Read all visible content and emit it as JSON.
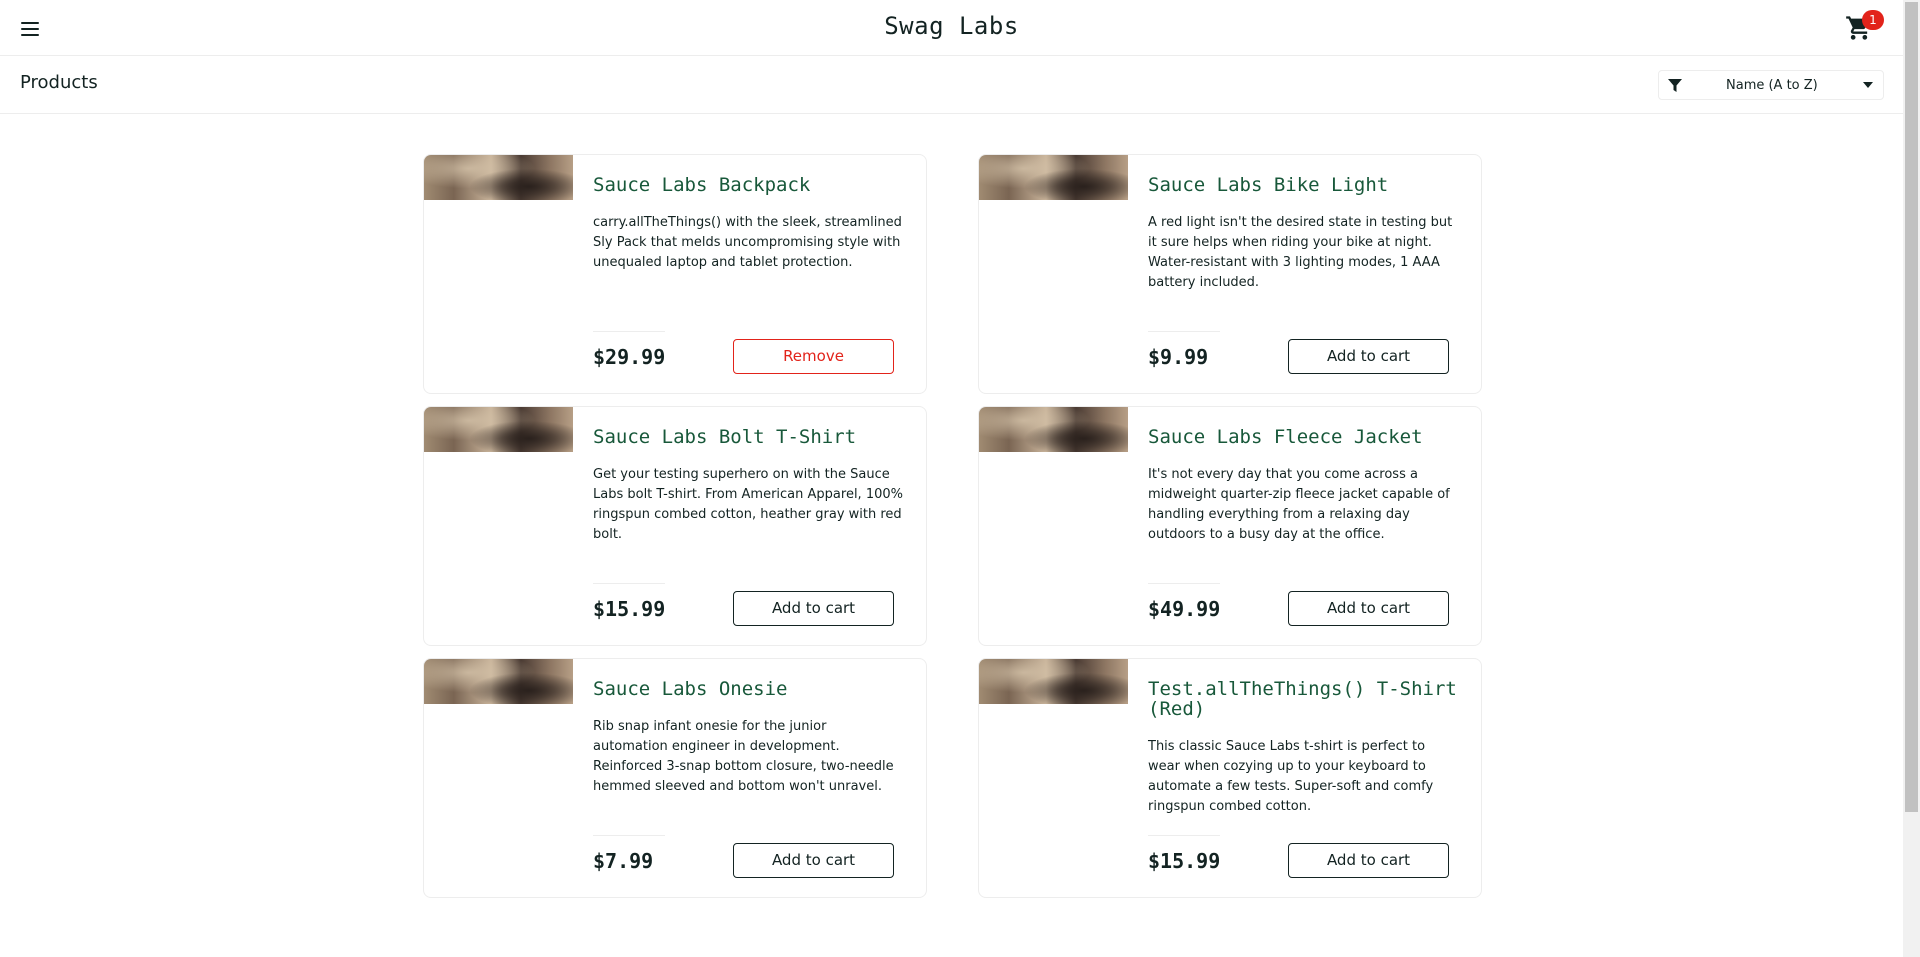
{
  "header": {
    "title": "Swag Labs",
    "cart_count": "1"
  },
  "subheader": {
    "title": "Products",
    "sort_value": "Name (A to Z)"
  },
  "products": [
    {
      "name": "Sauce Labs Backpack",
      "description": "carry.allTheThings() with the sleek, streamlined Sly Pack that melds uncompromising style with unequaled laptop and tablet protection.",
      "price": "$29.99",
      "button_label": "Remove",
      "in_cart": true
    },
    {
      "name": "Sauce Labs Bike Light",
      "description": "A red light isn't the desired state in testing but it sure helps when riding your bike at night. Water-resistant with 3 lighting modes, 1 AAA battery included.",
      "price": "$9.99",
      "button_label": "Add to cart",
      "in_cart": false
    },
    {
      "name": "Sauce Labs Bolt T-Shirt",
      "description": "Get your testing superhero on with the Sauce Labs bolt T-shirt. From American Apparel, 100% ringspun combed cotton, heather gray with red bolt.",
      "price": "$15.99",
      "button_label": "Add to cart",
      "in_cart": false
    },
    {
      "name": "Sauce Labs Fleece Jacket",
      "description": "It's not every day that you come across a midweight quarter-zip fleece jacket capable of handling everything from a relaxing day outdoors to a busy day at the office.",
      "price": "$49.99",
      "button_label": "Add to cart",
      "in_cart": false
    },
    {
      "name": "Sauce Labs Onesie",
      "description": "Rib snap infant onesie for the junior automation engineer in development. Reinforced 3-snap bottom closure, two-needle hemmed sleeved and bottom won't unravel.",
      "price": "$7.99",
      "button_label": "Add to cart",
      "in_cart": false
    },
    {
      "name": "Test.allTheThings() T-Shirt (Red)",
      "description": "This classic Sauce Labs t-shirt is perfect to wear when cozying up to your keyboard to automate a few tests. Super-soft and comfy ringspun combed cotton.",
      "price": "$15.99",
      "button_label": "Add to cart",
      "in_cart": false
    }
  ],
  "colors": {
    "accent_green": "#18583a",
    "remove_red": "#e2231a",
    "badge_red": "#e2231a",
    "text": "#132322"
  }
}
